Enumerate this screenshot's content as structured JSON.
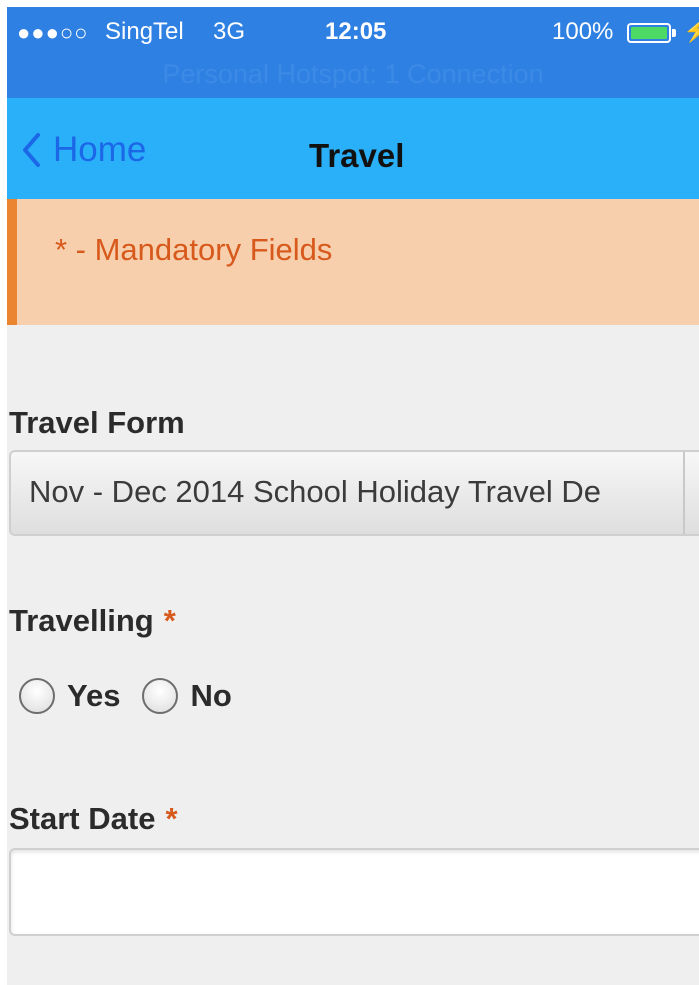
{
  "status_bar": {
    "signal": "●●●○○",
    "carrier": "SingTel",
    "network": "3G",
    "time": "12:05",
    "battery_percent": "100%",
    "battery_level": 1.0,
    "charging_icon": "⚡",
    "hotspot_text": "Personal Hotspot: 1 Connection"
  },
  "nav": {
    "back_label": "Home",
    "title": "Travel"
  },
  "banner": {
    "text": "* - Mandatory Fields"
  },
  "form": {
    "travel_form": {
      "label": "Travel Form",
      "selected_value": "Nov - Dec 2014 School Holiday Travel De"
    },
    "travelling": {
      "label": "Travelling",
      "required_mark": "*",
      "options": [
        "Yes",
        "No"
      ]
    },
    "start_date": {
      "label": "Start Date",
      "required_mark": "*",
      "value": ""
    }
  },
  "colors": {
    "status_bar": "#2f80e3",
    "nav_bar": "#2ab0f8",
    "back_link": "#1b67e8",
    "banner_bg": "#f7cfad",
    "banner_accent": "#ec8530",
    "required": "#d7591c",
    "page_bg": "#efefef"
  }
}
